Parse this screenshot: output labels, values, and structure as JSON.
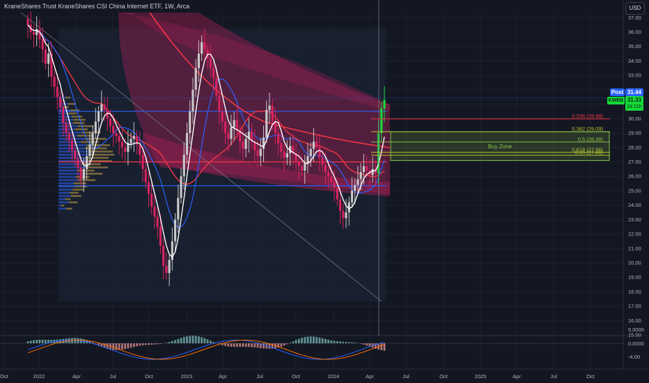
{
  "header": {
    "title": "KraneShares Trust KraneShares CSI China Internet ETF, 1W, Arca",
    "currency": "USD"
  },
  "colors": {
    "background": "#131722",
    "up": "#26a69a",
    "candle_body_up": "#c8c8c8",
    "candle_body_down": "#d6245f",
    "channel_fill": "#9c1f52",
    "moving_average_red": "#f23645",
    "moving_average_blue": "#2962ff",
    "horizontal_blue": "#2962ff",
    "horizontal_red": "#f23645",
    "buy_zone": "#8bc34a",
    "last_price": "#2962ff",
    "ticker_tag": "#16d93a"
  },
  "price_tags": {
    "post_label": "Post",
    "post_value": "31.44",
    "ticker_label": "KWEB",
    "ticker_value": "31.33",
    "ticker_time": "2d 21h"
  },
  "chart_data": {
    "type": "candlestick",
    "x_ticks": [
      "Oct",
      "2022",
      "Apr",
      "Jul",
      "Oct",
      "2023",
      "Apr",
      "Jul",
      "Oct",
      "2024",
      "Apr",
      "Jul",
      "Oct",
      "2025",
      "Apr",
      "Jul",
      "Oct"
    ],
    "y_ticks": [
      "37.00",
      "36.00",
      "35.00",
      "34.00",
      "33.00",
      "32.00",
      "31.00",
      "30.00",
      "29.00",
      "28.00",
      "27.00",
      "26.00",
      "25.00",
      "24.00",
      "23.00",
      "22.00",
      "21.00",
      "20.00",
      "19.00",
      "18.00",
      "17.00",
      "16.00",
      "15.00"
    ],
    "ylim": [
      15,
      37.5
    ],
    "horizontal_lines": [
      {
        "price": 30.5,
        "color": "blue"
      },
      {
        "price": 27.0,
        "color": "red"
      },
      {
        "price": 25.35,
        "color": "blue"
      }
    ],
    "fib_levels": [
      {
        "label": "0.236 (29.98)",
        "price": 29.98
      },
      {
        "label": "0.382 (29.09)",
        "price": 29.09
      },
      {
        "label": "0.5 (28.38)",
        "price": 28.38
      },
      {
        "label": "0.618 (27.66)",
        "price": 27.66
      },
      {
        "label": "0.65 (27.46)",
        "price": 27.46
      }
    ],
    "buy_zone": {
      "label": "Buy Zone",
      "top": 29.09,
      "bottom": 27.1
    },
    "last_price": 31.44,
    "weekly_closes": [
      36.5,
      36.0,
      35.8,
      36.2,
      35.5,
      34.8,
      33.8,
      34.5,
      32.9,
      32.2,
      31.5,
      30.8,
      29.7,
      29.0,
      28.5,
      27.8,
      27.2,
      26.6,
      25.8,
      26.5,
      27.4,
      28.2,
      29.0,
      29.8,
      30.5,
      31.0,
      30.6,
      30.0,
      29.5,
      29.0,
      28.8,
      28.4,
      28.0,
      27.7,
      28.3,
      28.6,
      28.8,
      28.2,
      27.5,
      26.5,
      25.6,
      24.8,
      23.9,
      23.2,
      22.5,
      21.2,
      19.8,
      19.3,
      20.2,
      21.5,
      23.0,
      24.5,
      26.0,
      27.5,
      29.0,
      30.5,
      32.0,
      33.5,
      34.5,
      35.3,
      34.8,
      34.2,
      33.5,
      32.8,
      31.6,
      30.5,
      29.8,
      29.0,
      28.6,
      29.4,
      29.9,
      29.2,
      28.4,
      27.9,
      28.6,
      29.1,
      28.4,
      27.8,
      27.4,
      27.9,
      28.7,
      30.6,
      30.9,
      29.8,
      29.0,
      28.3,
      27.7,
      27.3,
      27.6,
      28.1,
      27.6,
      27.0,
      26.7,
      26.4,
      26.9,
      27.4,
      27.9,
      28.4,
      28.0,
      27.3,
      26.8,
      26.3,
      26.0,
      25.6,
      25.2,
      24.4,
      23.6,
      23.1,
      23.5,
      24.2,
      25.0,
      25.4,
      25.8,
      26.3,
      26.7,
      26.4,
      26.1,
      26.5,
      26.2,
      29.0,
      30.7,
      31.3
    ]
  }
}
